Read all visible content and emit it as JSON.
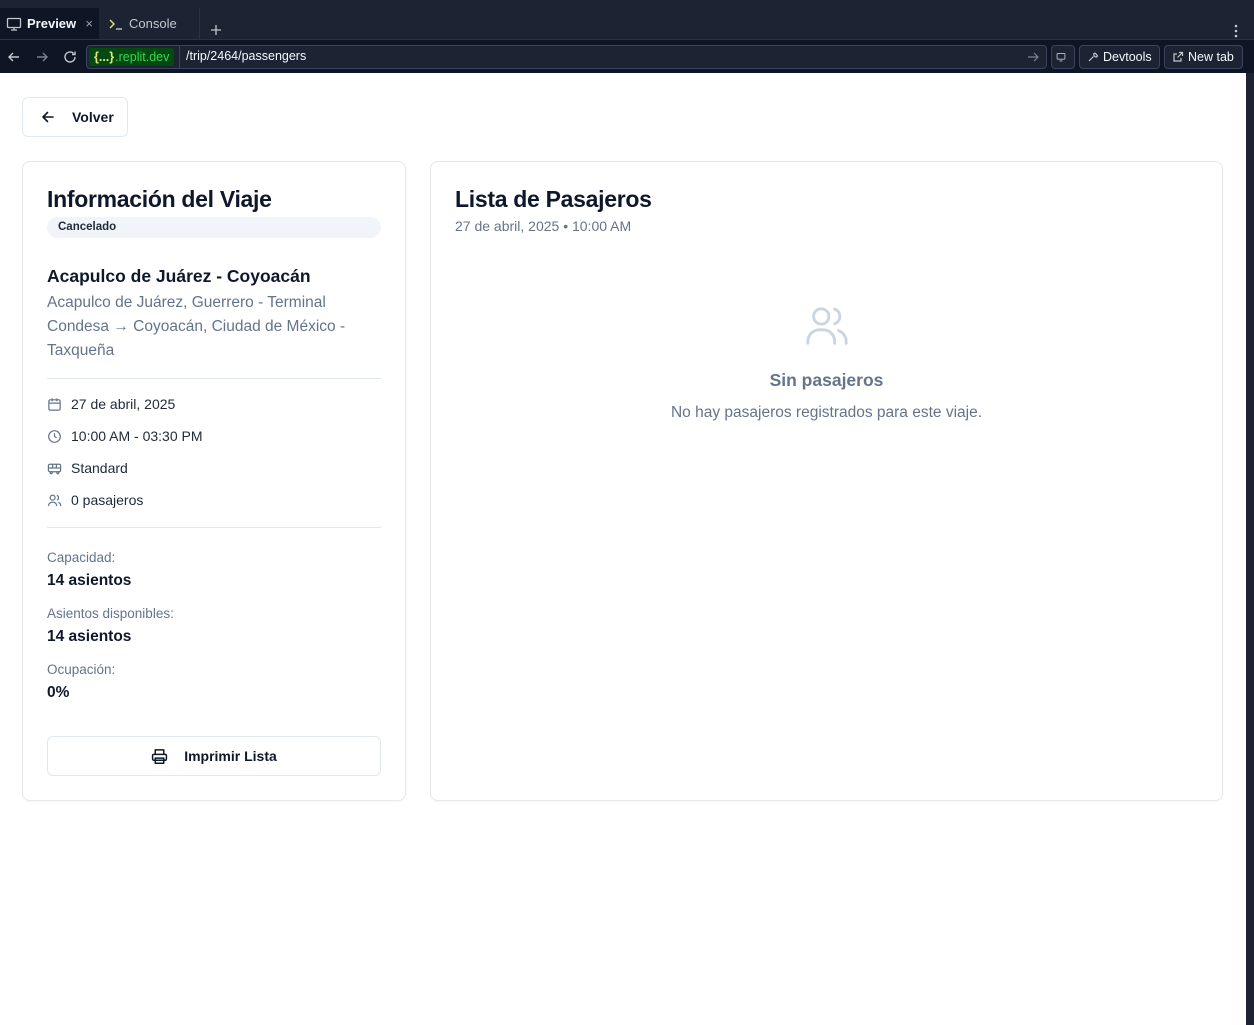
{
  "browser": {
    "tabs": [
      {
        "label": "Preview",
        "icon": "monitor-icon"
      },
      {
        "label": "Console",
        "icon": "terminal-icon"
      }
    ],
    "tab_close": "×",
    "domain_braces": "{...}",
    "domain": ".replit.dev",
    "path": "/trip/2464/passengers",
    "devtools_label": "Devtools",
    "newtab_label": "New tab",
    "colors": {
      "chrome_bg": "#0e1525",
      "domain_green": "#38d655"
    }
  },
  "page": {
    "back_label": "Volver",
    "trip_info": {
      "title": "Información del Viaje",
      "status_badge": "Cancelado",
      "route_title": "Acapulco de Juárez - Coyoacán",
      "route_description": "Acapulco de Juárez, Guerrero - Terminal Condesa → Coyoacán, Ciudad de México - Taxqueña",
      "date": "27 de abril, 2025",
      "time": "10:00 AM - 03:30 PM",
      "bus_type": "Standard",
      "passengers_count": "0 pasajeros",
      "capacity_label": "Capacidad:",
      "capacity_value": "14 asientos",
      "available_label": "Asientos disponibles:",
      "available_value": "14 asientos",
      "occupancy_label": "Ocupación:",
      "occupancy_value": "0%",
      "print_label": "Imprimir Lista"
    },
    "passenger_list": {
      "title": "Lista de Pasajeros",
      "subtitle": "27 de abril, 2025 • 10:00 AM",
      "empty_title": "Sin pasajeros",
      "empty_text": "No hay pasajeros registrados para este viaje."
    }
  }
}
